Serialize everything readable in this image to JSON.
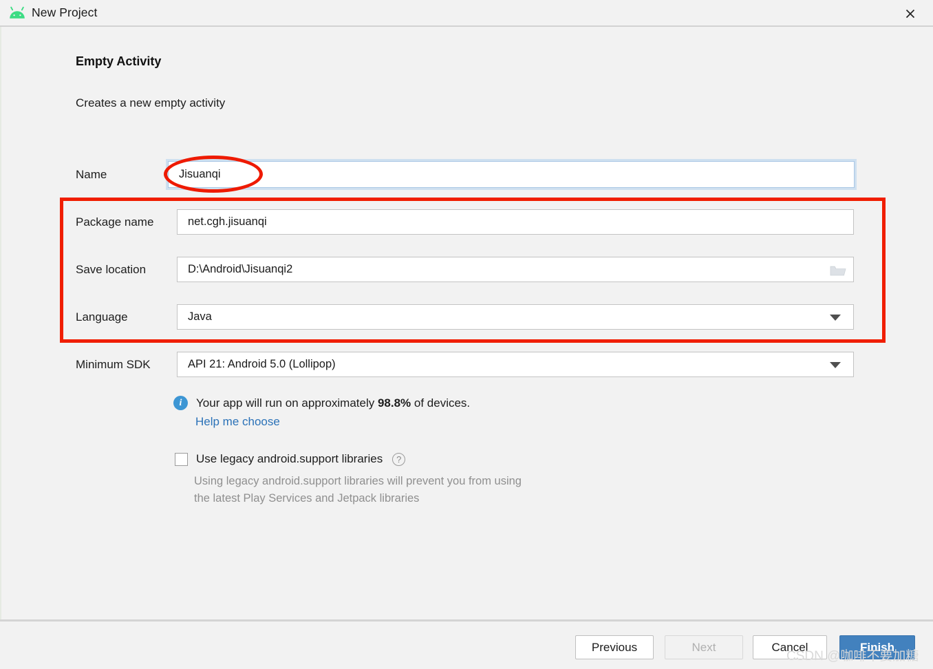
{
  "window": {
    "title": "New Project",
    "app_icon": "android-robot-icon",
    "close_icon": "close-icon"
  },
  "content": {
    "heading": "Empty Activity",
    "subheading": "Creates a new empty activity"
  },
  "form": {
    "name": {
      "label": "Name",
      "value": "Jisuanqi",
      "focused": true
    },
    "package_name": {
      "label": "Package name",
      "value": "net.cgh.jisuanqi"
    },
    "save_location": {
      "label": "Save location",
      "value": "D:\\Android\\Jisuanqi2",
      "browse_icon": "folder-icon"
    },
    "language": {
      "label": "Language",
      "value": "Java",
      "dropdown_icon": "chevron-down-icon"
    },
    "minimum_sdk": {
      "label": "Minimum SDK",
      "value": "API 21: Android 5.0 (Lollipop)",
      "dropdown_icon": "chevron-down-icon"
    }
  },
  "info": {
    "icon": "info-icon",
    "icon_glyph": "i",
    "text_before": "Your app will run on approximately ",
    "percentage": "98.8%",
    "text_after": " of devices.",
    "help_link": "Help me choose"
  },
  "legacy": {
    "checked": false,
    "label": "Use legacy android.support libraries",
    "help_icon": "question-mark-icon",
    "help_glyph": "?",
    "hint_line_1": "Using legacy android.support libraries will prevent you from using",
    "hint_line_2": "the latest Play Services and Jetpack libraries"
  },
  "footer": {
    "previous": "Previous",
    "next": "Next",
    "cancel": "Cancel",
    "finish": "Finish"
  },
  "watermark": "CSDN @咖啡不要加糖",
  "colors": {
    "accent_blue": "#4281be",
    "link_blue": "#2b72b8",
    "info_blue": "#3d96d4",
    "annotation_red": "#f01e00",
    "android_green": "#3ddc84",
    "dialog_bg": "#f2f2f2"
  }
}
